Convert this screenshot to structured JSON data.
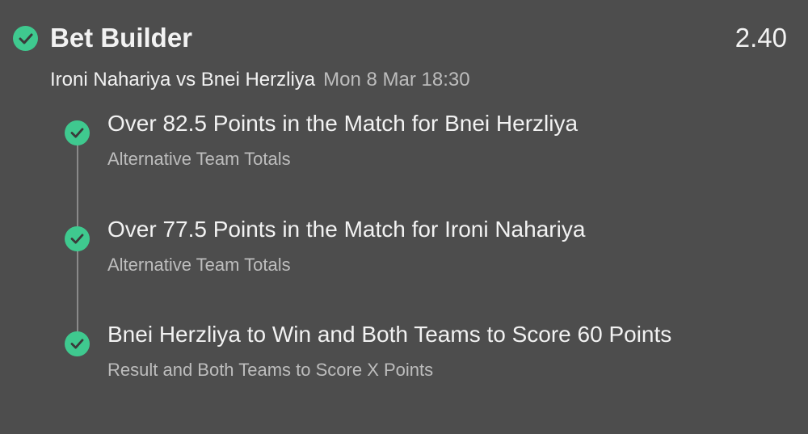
{
  "bet": {
    "title": "Bet Builder",
    "odds": "2.40",
    "match": "Ironi Nahariya vs Bnei Herzliya",
    "datetime": "Mon 8 Mar 18:30"
  },
  "legs": [
    {
      "selection": "Over 82.5 Points in the Match for Bnei Herzliya",
      "market": "Alternative Team Totals"
    },
    {
      "selection": "Over 77.5 Points in the Match for Ironi Nahariya",
      "market": "Alternative Team Totals"
    },
    {
      "selection": "Bnei Herzliya to Win and Both Teams to Score 60 Points",
      "market": "Result and Both Teams to Score X Points"
    }
  ],
  "icons": {
    "status": "check-circle-icon",
    "accent": "#3fc98f"
  }
}
